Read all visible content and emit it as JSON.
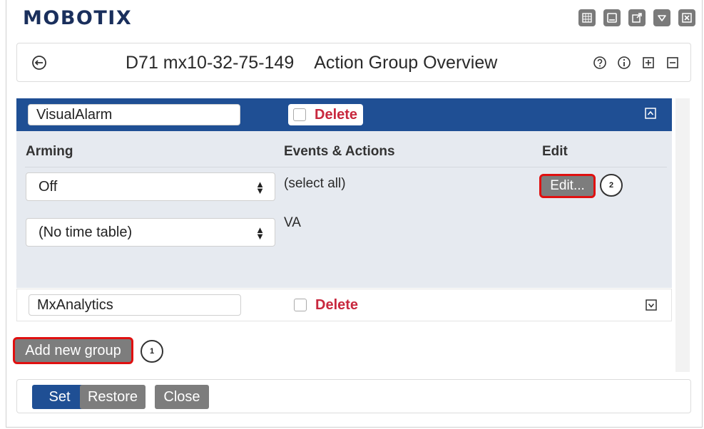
{
  "brand": {
    "logo_text": "MOBOTIX",
    "color": "#1a2f5c"
  },
  "top_icons": [
    "grid-icon",
    "window-icon",
    "external-link-icon",
    "dropdown-icon",
    "close-box-icon"
  ],
  "titlebar": {
    "device": "D71 mx10-32-75-149",
    "title": "Action Group Overview",
    "icons": [
      "help-icon",
      "info-icon",
      "expand-all-icon",
      "collapse-all-icon"
    ]
  },
  "groups": [
    {
      "name": "VisualAlarm",
      "delete_label": "Delete",
      "expanded": true,
      "columns": {
        "arming": "Arming",
        "events": "Events & Actions",
        "edit": "Edit"
      },
      "arming_value": "Off",
      "time_table_value": "(No time table)",
      "events_select_all": "(select all)",
      "events_value": "VA",
      "edit_label": "Edit...",
      "edit_badge": "2"
    },
    {
      "name": "MxAnalytics",
      "delete_label": "Delete",
      "expanded": false
    }
  ],
  "add_group": {
    "label": "Add new group",
    "badge": "1"
  },
  "footer": {
    "set": "Set",
    "restore": "Restore",
    "close": "Close"
  },
  "colors": {
    "header_blue": "#1f4f94",
    "panel_bg": "#e6eaf0",
    "delete_red": "#c8283e",
    "highlight_red": "#e01010"
  }
}
